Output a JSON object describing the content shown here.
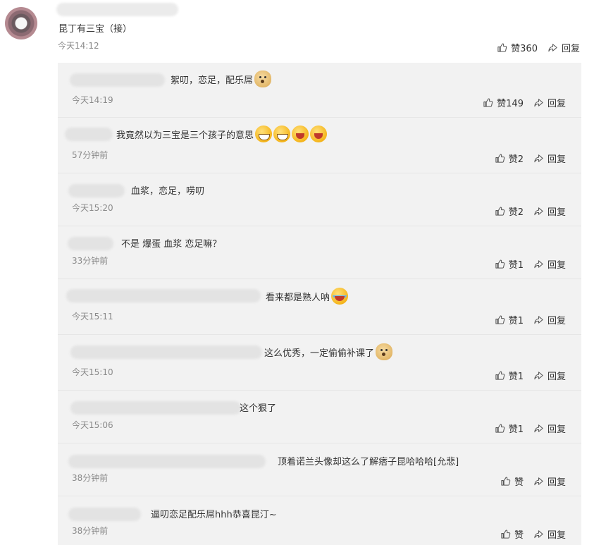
{
  "main_comment": {
    "text": "昆丁有三宝（接）",
    "time": "今天14:12",
    "like_label": "赞360",
    "reply_label": "回复"
  },
  "replies": [
    {
      "text": "絮叨，恋足，配乐屌",
      "emojis": [
        "doge-icon"
      ],
      "time": "今天14:19",
      "like_label": "赞149",
      "reply_label": "回复"
    },
    {
      "text": "我竟然以为三宝是三个孩子的意思",
      "emojis": [
        "grin-icon",
        "grin-icon",
        "laugh-icon",
        "laugh-icon"
      ],
      "time": "57分钟前",
      "like_label": "赞2",
      "reply_label": "回复"
    },
    {
      "text": "血浆，恋足，唠叨",
      "emojis": [],
      "time": "今天15:20",
      "like_label": "赞2",
      "reply_label": "回复"
    },
    {
      "text": "不是 爆蛋 血浆 恋足嘛？",
      "emojis": [],
      "time": "33分钟前",
      "like_label": "赞1",
      "reply_label": "回复"
    },
    {
      "text": "看来都是熟人呐",
      "emojis": [
        "laugh-cry-icon"
      ],
      "time": "今天15:11",
      "like_label": "赞1",
      "reply_label": "回复"
    },
    {
      "text": "这么优秀，一定偷偷补课了",
      "emojis": [
        "doge-icon"
      ],
      "time": "今天15:10",
      "like_label": "赞1",
      "reply_label": "回复"
    },
    {
      "text": "这个狠了",
      "emojis": [],
      "time": "今天15:06",
      "like_label": "赞1",
      "reply_label": "回复"
    },
    {
      "text": "顶着诺兰头像却这么了解痞子昆哈哈哈[允悲]",
      "emojis": [],
      "time": "38分钟前",
      "like_label": "赞",
      "reply_label": "回复"
    },
    {
      "text": "逼叨恋足配乐屌hhh恭喜昆汀~",
      "emojis": [],
      "time": "38分钟前",
      "like_label": "赞",
      "reply_label": "回复"
    }
  ]
}
